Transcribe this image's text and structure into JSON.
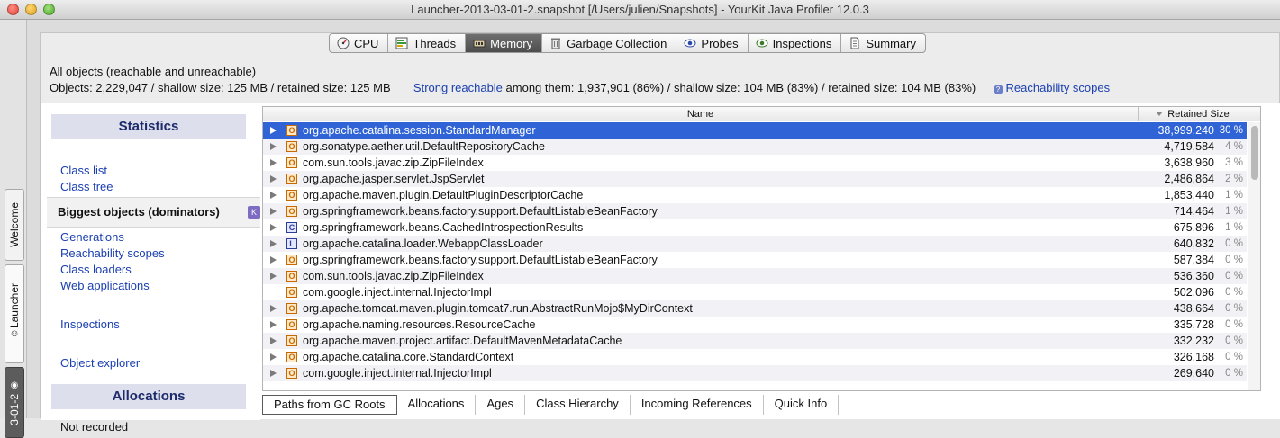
{
  "window": {
    "title": "Launcher-2013-03-01-2.snapshot [/Users/julien/Snapshots] - YourKit Java Profiler 12.0.3"
  },
  "side_tabs": {
    "welcome": "Welcome",
    "launcher": "Launcher",
    "snapshot": "3-01-2"
  },
  "tabs": [
    {
      "label": "CPU",
      "icon": "gauge-icon"
    },
    {
      "label": "Threads",
      "icon": "threads-icon"
    },
    {
      "label": "Memory",
      "icon": "memory-chip-icon",
      "active": true
    },
    {
      "label": "Garbage Collection",
      "icon": "trash-can-icon"
    },
    {
      "label": "Probes",
      "icon": "eye-probe-icon"
    },
    {
      "label": "Inspections",
      "icon": "eye-inspect-icon"
    },
    {
      "label": "Summary",
      "icon": "document-icon"
    }
  ],
  "header": {
    "line1": "All objects (reachable and unreachable)",
    "objects_summary": "Objects: 2,229,047 / shallow size: 125 MB / retained size: 125 MB",
    "strong_reachable_link": "Strong reachable",
    "strong_reachable_rest": " among them: 1,937,901 (86%) / shallow size: 104 MB (83%) / retained size: 104 MB (83%)",
    "reachability_scopes_link": "Reachability scopes"
  },
  "sidebar": {
    "statistics_title": "Statistics",
    "class_list": "Class list",
    "class_tree": "Class tree",
    "selected_item": "Biggest objects (dominators)",
    "selected_badge": "K",
    "generations": "Generations",
    "reachability_scopes": "Reachability scopes",
    "class_loaders": "Class loaders",
    "web_applications": "Web applications",
    "inspections": "Inspections",
    "object_explorer": "Object explorer",
    "allocations_title": "Allocations",
    "not_recorded": "Not recorded"
  },
  "table": {
    "col_name": "Name",
    "col_retained": "Retained Size",
    "rows": [
      {
        "icon": "O",
        "name": "org.apache.catalina.session.StandardManager",
        "value": "38,999,240",
        "pct": "30 %",
        "expandable": true,
        "selected": true
      },
      {
        "icon": "O",
        "name": "org.sonatype.aether.util.DefaultRepositoryCache",
        "value": "4,719,584",
        "pct": "4 %",
        "expandable": true
      },
      {
        "icon": "O",
        "name": "com.sun.tools.javac.zip.ZipFileIndex",
        "value": "3,638,960",
        "pct": "3 %",
        "expandable": true
      },
      {
        "icon": "O",
        "name": "org.apache.jasper.servlet.JspServlet",
        "value": "2,486,864",
        "pct": "2 %",
        "expandable": true
      },
      {
        "icon": "O",
        "name": "org.apache.maven.plugin.DefaultPluginDescriptorCache",
        "value": "1,853,440",
        "pct": "1 %",
        "expandable": true
      },
      {
        "icon": "O",
        "name": "org.springframework.beans.factory.support.DefaultListableBeanFactory",
        "value": "714,464",
        "pct": "1 %",
        "expandable": true
      },
      {
        "icon": "C",
        "name": "org.springframework.beans.CachedIntrospectionResults",
        "value": "675,896",
        "pct": "1 %",
        "expandable": true
      },
      {
        "icon": "L",
        "name": "org.apache.catalina.loader.WebappClassLoader",
        "value": "640,832",
        "pct": "0 %",
        "expandable": true
      },
      {
        "icon": "O",
        "name": "org.springframework.beans.factory.support.DefaultListableBeanFactory",
        "value": "587,384",
        "pct": "0 %",
        "expandable": true
      },
      {
        "icon": "O",
        "name": "com.sun.tools.javac.zip.ZipFileIndex",
        "value": "536,360",
        "pct": "0 %",
        "expandable": true
      },
      {
        "icon": "O",
        "name": "com.google.inject.internal.InjectorImpl",
        "value": "502,096",
        "pct": "0 %",
        "expandable": false
      },
      {
        "icon": "O",
        "name": "org.apache.tomcat.maven.plugin.tomcat7.run.AbstractRunMojo$MyDirContext",
        "value": "438,664",
        "pct": "0 %",
        "expandable": true
      },
      {
        "icon": "O",
        "name": "org.apache.naming.resources.ResourceCache",
        "value": "335,728",
        "pct": "0 %",
        "expandable": true
      },
      {
        "icon": "O",
        "name": "org.apache.maven.project.artifact.DefaultMavenMetadataCache",
        "value": "332,232",
        "pct": "0 %",
        "expandable": true
      },
      {
        "icon": "O",
        "name": "org.apache.catalina.core.StandardContext",
        "value": "326,168",
        "pct": "0 %",
        "expandable": true
      },
      {
        "icon": "O",
        "name": "com.google.inject.internal.InjectorImpl",
        "value": "269,640",
        "pct": "0 %",
        "expandable": true
      }
    ]
  },
  "bottom_tabs": [
    {
      "label": "Paths from GC Roots",
      "active": true
    },
    {
      "label": "Allocations"
    },
    {
      "label": "Ages"
    },
    {
      "label": "Class Hierarchy"
    },
    {
      "label": "Incoming References"
    },
    {
      "label": "Quick Info"
    }
  ],
  "colors": {
    "selection": "#2f63d6",
    "link": "#1a3fb0",
    "section_header_bg": "#dde0ec"
  }
}
